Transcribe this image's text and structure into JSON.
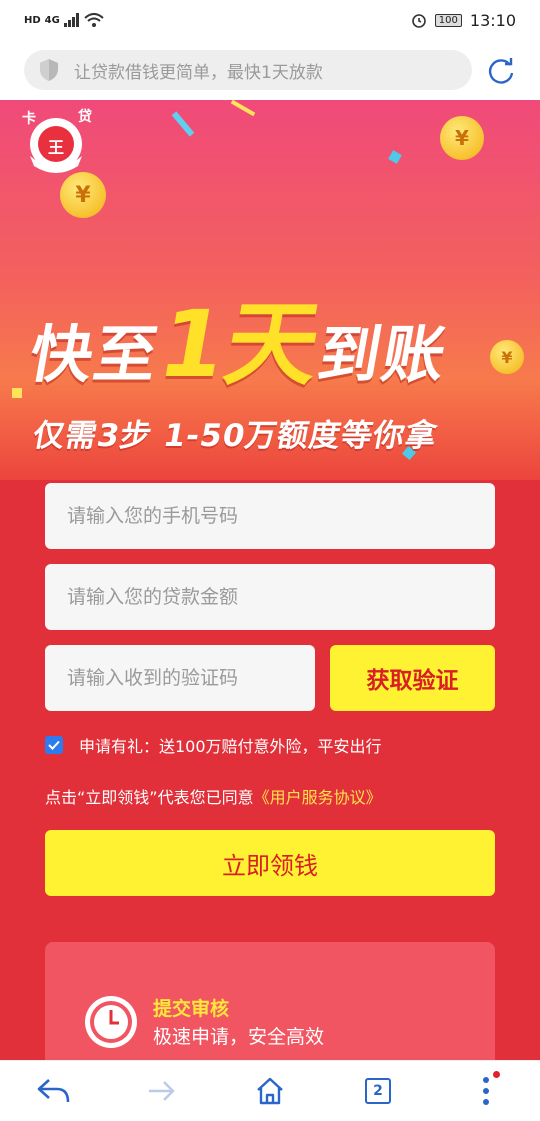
{
  "status_bar": {
    "network": "HD",
    "signal": "4G",
    "battery": "100",
    "time": "13:10"
  },
  "address_bar": {
    "text": "让贷款借钱更简单，最快1天放款"
  },
  "banner": {
    "logo_text_left": "卡",
    "logo_text_right": "贷",
    "logo_center": "王",
    "headline_pre": "快至",
    "headline_big": "1天",
    "headline_post": "到账",
    "subline": "仅需3步  1-50万额度等你拿",
    "coin_symbol": "¥"
  },
  "form": {
    "phone_placeholder": "请输入您的手机号码",
    "amount_placeholder": "请输入您的贷款金额",
    "code_placeholder": "请输入收到的验证码",
    "get_code_label": "获取验证",
    "gift_text": "申请有礼：送100万赔付意外险，平安出行",
    "agree_prefix": "点击“立即领钱”代表您已同意",
    "agree_link": "《用户服务协议》",
    "submit_label": "立即领钱"
  },
  "step": {
    "title": "提交审核",
    "desc": "极速申请，安全高效"
  },
  "bottom_nav": {
    "tab_count": "2"
  },
  "colors": {
    "accent_yellow": "#fff233",
    "brand_red": "#e1303a",
    "link_blue": "#2a66c9"
  }
}
